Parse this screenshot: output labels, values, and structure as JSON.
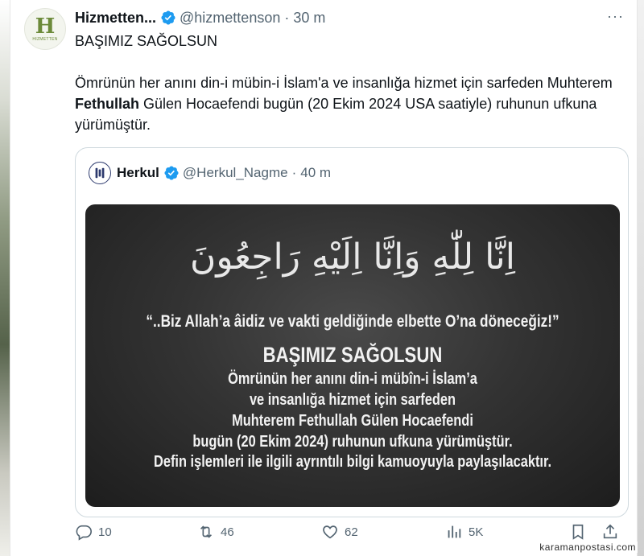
{
  "author": {
    "display_name": "Hizmetten...",
    "handle": "@hizmettenson",
    "time": "30 m",
    "avatar_letter": "H",
    "avatar_sub": "HIZMETTEN"
  },
  "more_icon": "···",
  "tweet": {
    "line1": "BAŞIMIZ SAĞOLSUN",
    "p2_a": "Ömrünün her anını din-i mübin-i İslam'a ve insanlığa hizmet için sarfeden Muhterem ",
    "p2_bold": "Fethullah",
    "p2_b": " Gülen Hocaefendi bugün (20 Ekim 2024 USA saatiyle) ruhunun ufkuna yürümüştür."
  },
  "quote": {
    "display_name": "Herkul",
    "handle": "@Herkul_Nagme",
    "time": "40 m",
    "media": {
      "arabic": "اِنَّا لِلّٰهِ وَاِنَّا اِلَيْهِ رَاجِعُونَ",
      "line1": "“..Biz Allah’a âidiz ve vakti geldiğinde elbette O’na döneceğiz!”",
      "line2": "BAŞIMIZ SAĞOLSUN",
      "line3": "Ömrünün her anını din-i mübîn-i İslam’a",
      "line4": "ve insanlığa hizmet için sarfeden",
      "line5": "Muhterem Fethullah Gülen Hocaefendi",
      "line6": "bugün (20 Ekim 2024) ruhunun ufkuna yürümüştür.",
      "line7": "Defin işlemleri ile ilgili ayrıntılı bilgi kamuoyuyla paylaşılacaktır."
    }
  },
  "actions": {
    "replies": "10",
    "reposts": "46",
    "likes": "62",
    "views": "5K"
  },
  "watermark": "karamanpostasi.com",
  "colors": {
    "verified": "#1d9bf0",
    "muted": "#536471",
    "border": "#cfd9de"
  }
}
